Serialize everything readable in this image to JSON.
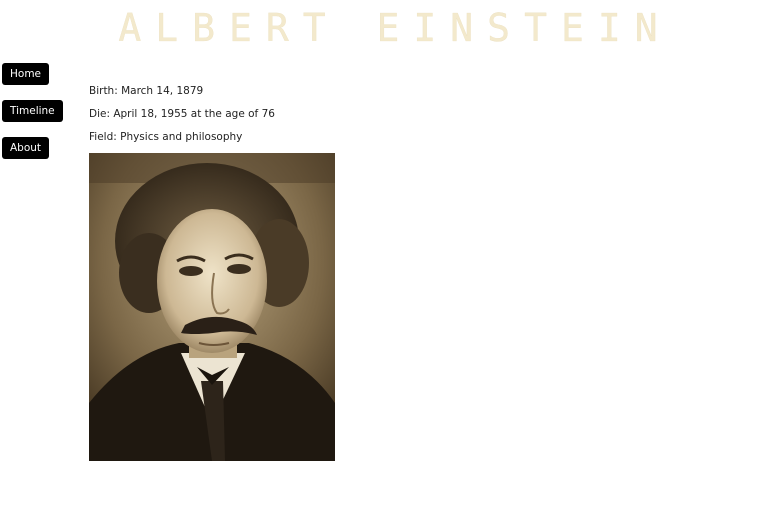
{
  "header": {
    "title": "ALBERT EINSTEIN"
  },
  "nav": {
    "items": [
      {
        "label": "Home"
      },
      {
        "label": "Timeline"
      },
      {
        "label": "About"
      }
    ]
  },
  "info": {
    "birth": "Birth: March 14, 1879",
    "death": "Die: April 18, 1955 at the age of 76",
    "field": "Field: Physics and philosophy"
  },
  "colors": {
    "title": "#f3e9cc",
    "button_bg": "#000000",
    "button_text": "#ffffff",
    "photo_tone": "#8a7656"
  }
}
